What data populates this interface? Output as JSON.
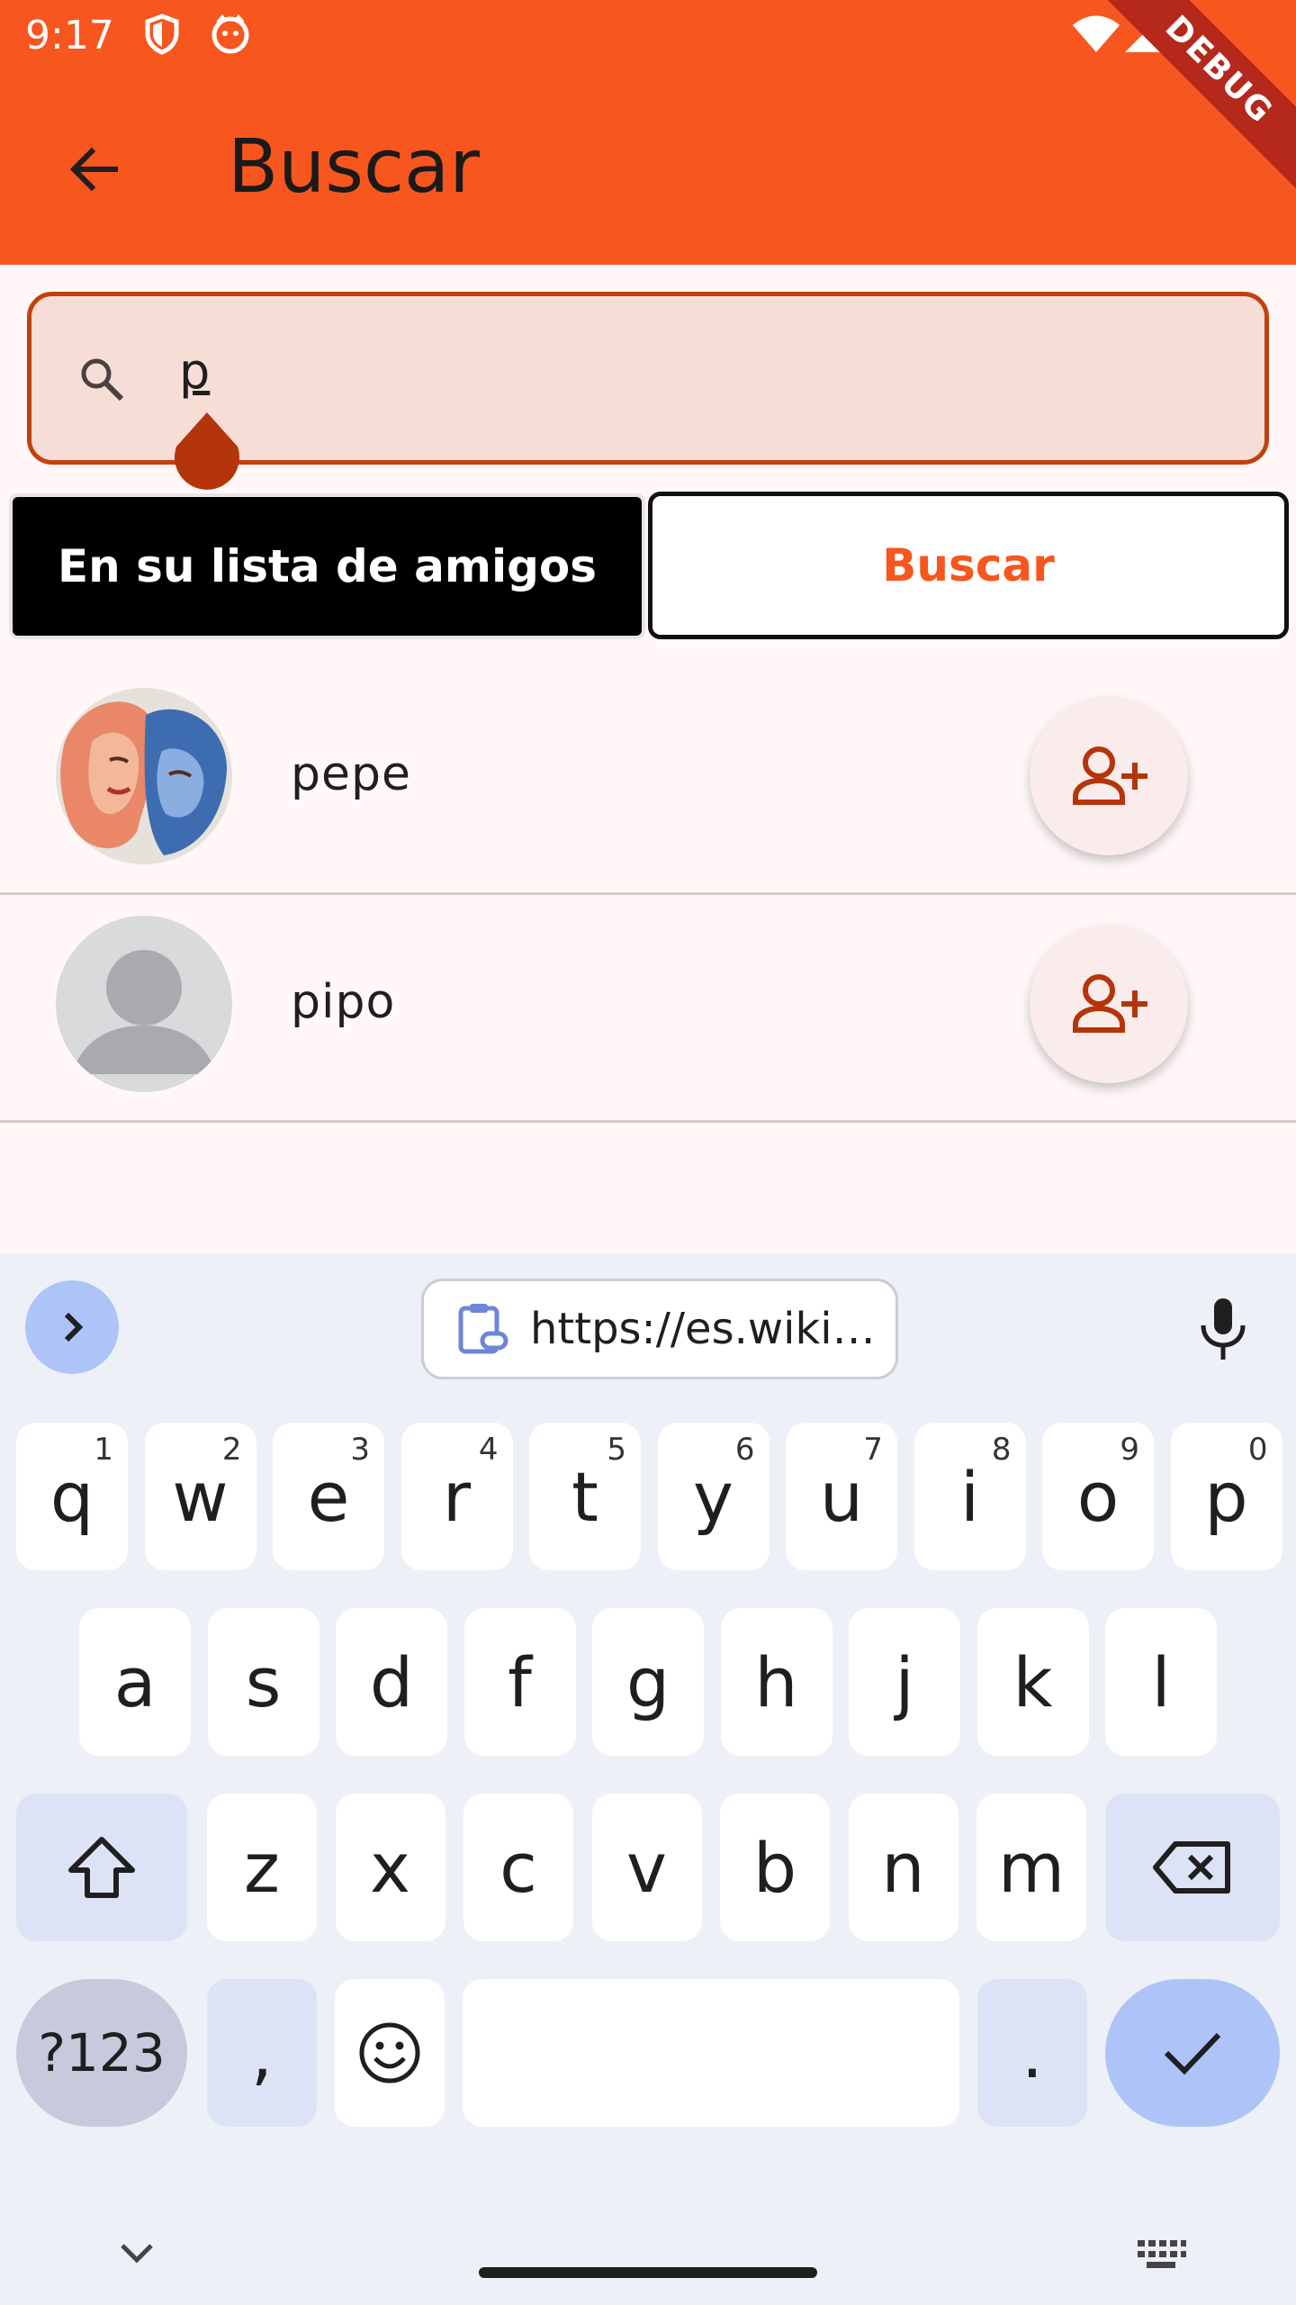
{
  "status_bar": {
    "time": "9:17"
  },
  "app_bar": {
    "title": "Buscar",
    "debug_label": "DEBUG"
  },
  "search": {
    "value": "p"
  },
  "tabs": {
    "friends_label": "En su lista de amigos",
    "search_label": "Buscar"
  },
  "results": [
    {
      "name": "pepe",
      "avatar": "painting-avatar"
    },
    {
      "name": "pipo",
      "avatar": "default-avatar"
    }
  ],
  "keyboard": {
    "clipboard_text": "https://es.wiki…",
    "row1": [
      {
        "k": "q",
        "h": "1"
      },
      {
        "k": "w",
        "h": "2"
      },
      {
        "k": "e",
        "h": "3"
      },
      {
        "k": "r",
        "h": "4"
      },
      {
        "k": "t",
        "h": "5"
      },
      {
        "k": "y",
        "h": "6"
      },
      {
        "k": "u",
        "h": "7"
      },
      {
        "k": "i",
        "h": "8"
      },
      {
        "k": "o",
        "h": "9"
      },
      {
        "k": "p",
        "h": "0"
      }
    ],
    "row2": [
      "a",
      "s",
      "d",
      "f",
      "g",
      "h",
      "j",
      "k",
      "l"
    ],
    "row3": [
      "z",
      "x",
      "c",
      "v",
      "b",
      "n",
      "m"
    ],
    "symbols_label": "?123",
    "comma": ",",
    "period": "."
  },
  "colors": {
    "accent": "#f7561e",
    "icon_dark_orange": "#b5350a"
  }
}
